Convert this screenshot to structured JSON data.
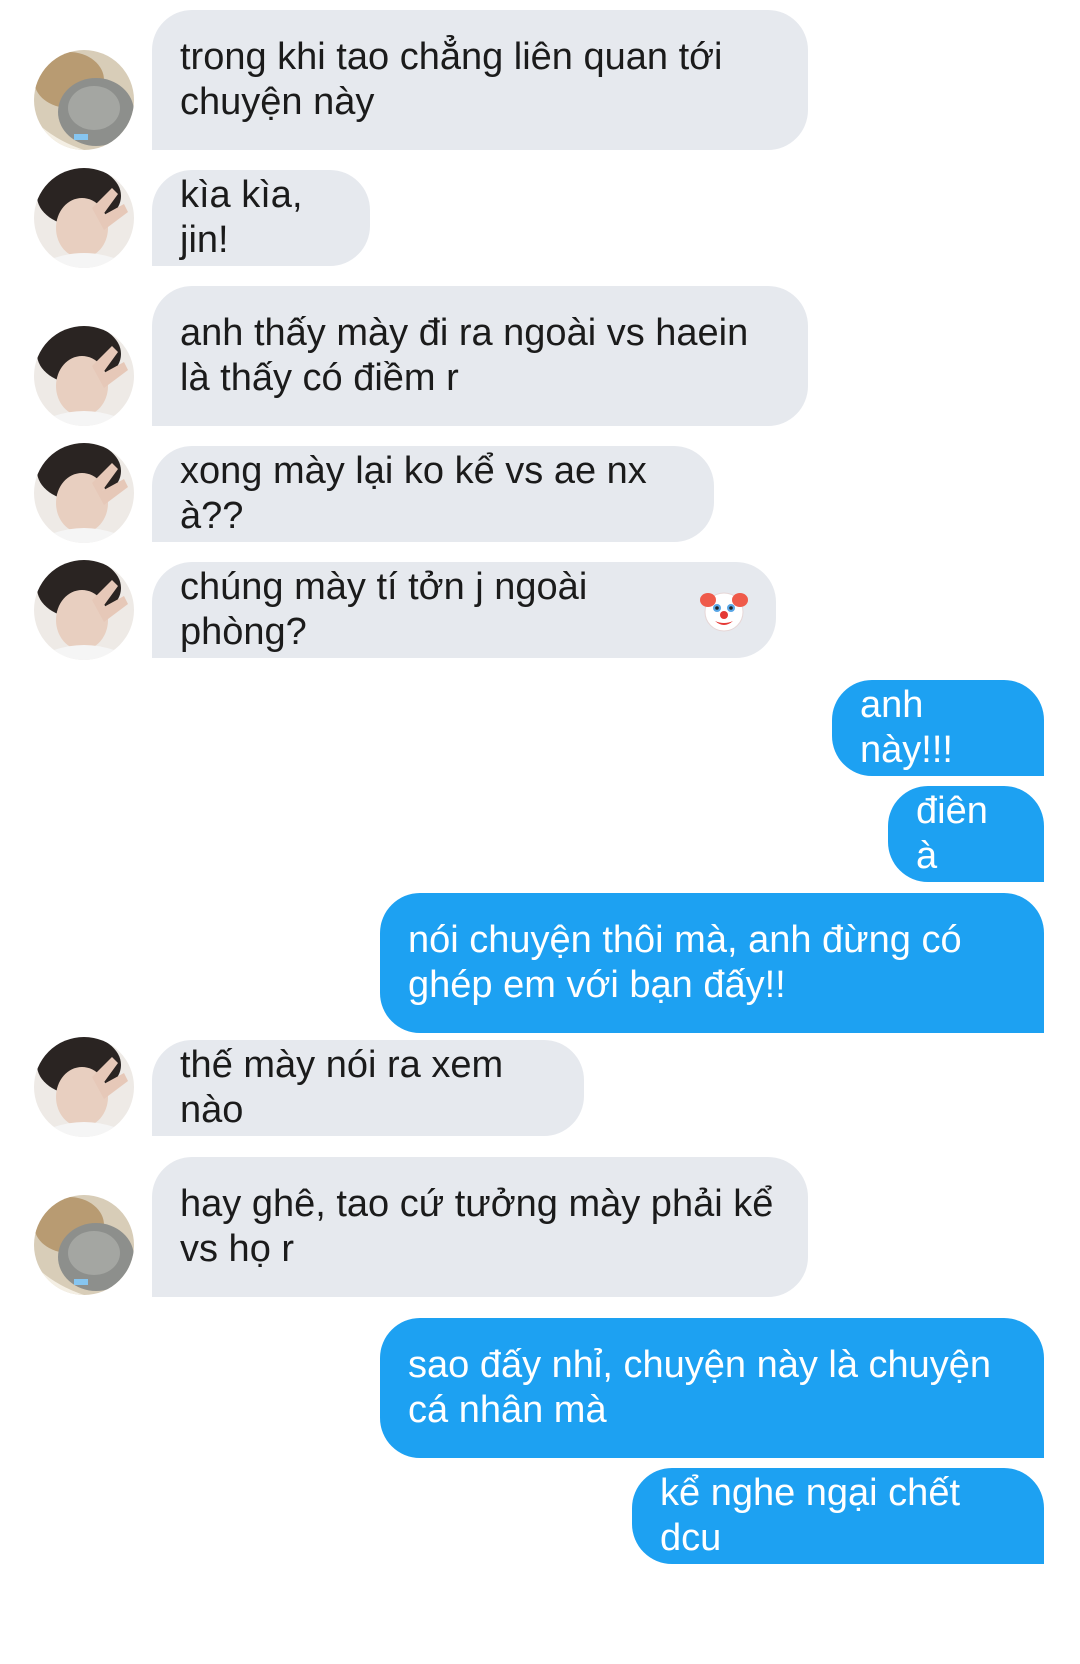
{
  "conversation": {
    "messages": [
      {
        "sender": "jin",
        "text": "trong khi tao chẳng liên quan tới chuyện này"
      },
      {
        "sender": "friend",
        "text": "kìa kìa, jin!"
      },
      {
        "sender": "friend",
        "text": "anh thấy mày đi ra ngoài vs haein là thấy có điềm r"
      },
      {
        "sender": "friend",
        "text": "xong mày lại ko kể vs ae nx à??"
      },
      {
        "sender": "friend",
        "text": "chúng mày tí tởn j ngoài phòng?",
        "emoji": "clown-face-icon"
      },
      {
        "sender": "me",
        "text": "anh này!!!"
      },
      {
        "sender": "me",
        "text": "điên à"
      },
      {
        "sender": "me",
        "text": "nói chuyện thôi mà, anh đừng có ghép em với bạn đấy!!"
      },
      {
        "sender": "friend",
        "text": "thế mày nói ra xem nào"
      },
      {
        "sender": "jin",
        "text": "hay ghê, tao cứ tưởng mày phải kể vs họ r"
      },
      {
        "sender": "me",
        "text": "sao đấy nhỉ, chuyện này là chuyện cá nhân mà"
      },
      {
        "sender": "me",
        "text": "kể nghe ngại chết dcu"
      }
    ]
  },
  "colors": {
    "incoming_bubble": "#e6e9ee",
    "outgoing_bubble": "#1da1f2",
    "incoming_text": "#1b1b1b",
    "outgoing_text": "#ffffff"
  }
}
